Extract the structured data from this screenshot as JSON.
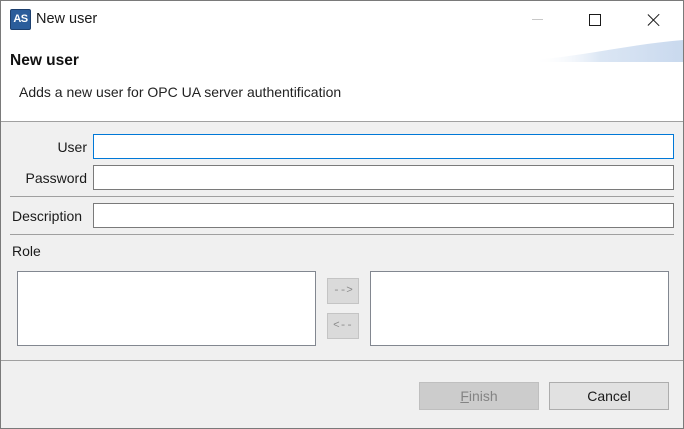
{
  "window": {
    "title": "New user",
    "app_icon_text": "AS"
  },
  "banner": {
    "title": "New user",
    "description": "Adds a new user for OPC UA server authentification"
  },
  "form": {
    "user_label": "User",
    "user_value": "",
    "password_label": "Password",
    "password_value": "",
    "description_label": "Description",
    "description_value": "",
    "role_label": "Role",
    "available_roles": [],
    "assigned_roles": [],
    "add_role_label": "-->",
    "remove_role_label": "<--"
  },
  "buttons": {
    "finish_mnemonic": "F",
    "finish_rest": "inish",
    "finish_enabled": false,
    "cancel_label": "Cancel"
  },
  "colors": {
    "focus_border": "#0078d7",
    "app_icon_bg": "#2b5d9b"
  }
}
